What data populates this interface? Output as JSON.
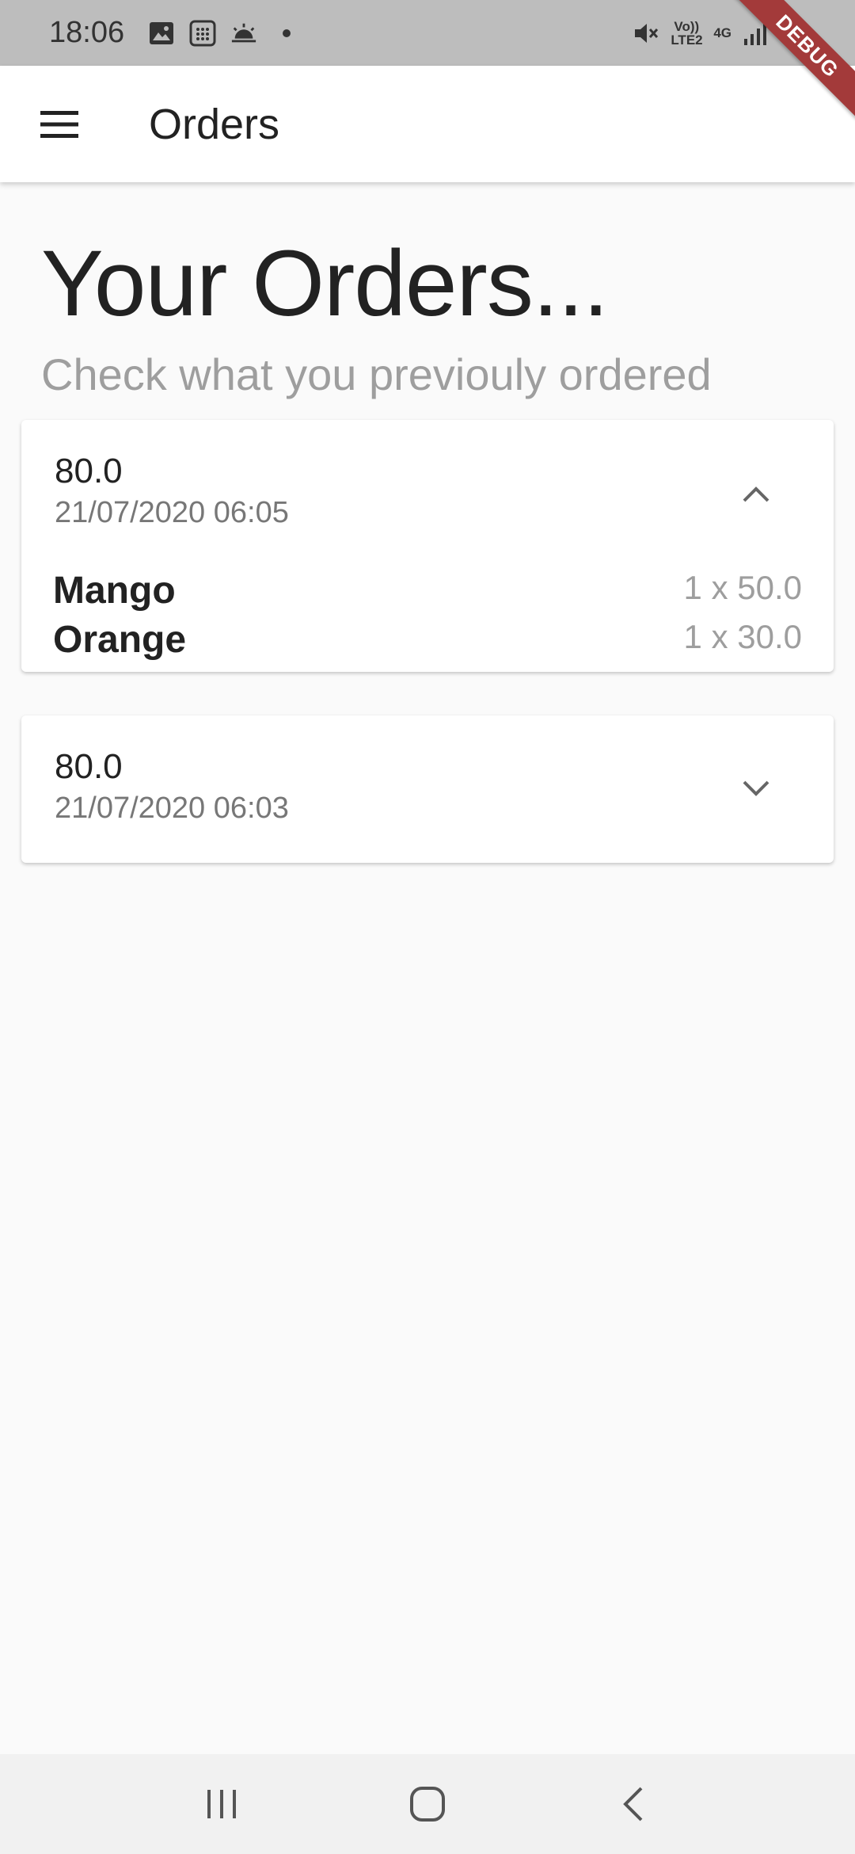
{
  "status_bar": {
    "time": "18:06",
    "volte_label": "Vo)) LTE2",
    "network_label": "4G",
    "icons": [
      "gallery-icon",
      "calendar-icon",
      "weather-icon",
      "notification-dot",
      "mute-icon",
      "signal-icon",
      "battery-icon"
    ]
  },
  "debug_banner": {
    "label": "DEBUG",
    "color": "#a33a3a"
  },
  "app_bar": {
    "title": "Orders",
    "menu_icon": "hamburger-menu-icon"
  },
  "page": {
    "heading": "Your Orders...",
    "subheading": "Check what you previouly ordered"
  },
  "orders": [
    {
      "total": "80.0",
      "date": "21/07/2020 06:05",
      "expanded": true,
      "toggle_icon": "chevron-up-icon",
      "items": [
        {
          "name": "Mango",
          "qty": "1 x 50.0"
        },
        {
          "name": "Orange",
          "qty": "1 x 30.0"
        }
      ]
    },
    {
      "total": "80.0",
      "date": "21/07/2020 06:03",
      "expanded": false,
      "toggle_icon": "chevron-down-icon",
      "items": []
    }
  ],
  "nav_bar": {
    "icons": [
      "recent-apps-icon",
      "home-icon",
      "back-icon"
    ]
  },
  "colors": {
    "background": "#fafafa",
    "status_bar": "#bdbdbd",
    "subtle_text": "#9e9e9e"
  }
}
